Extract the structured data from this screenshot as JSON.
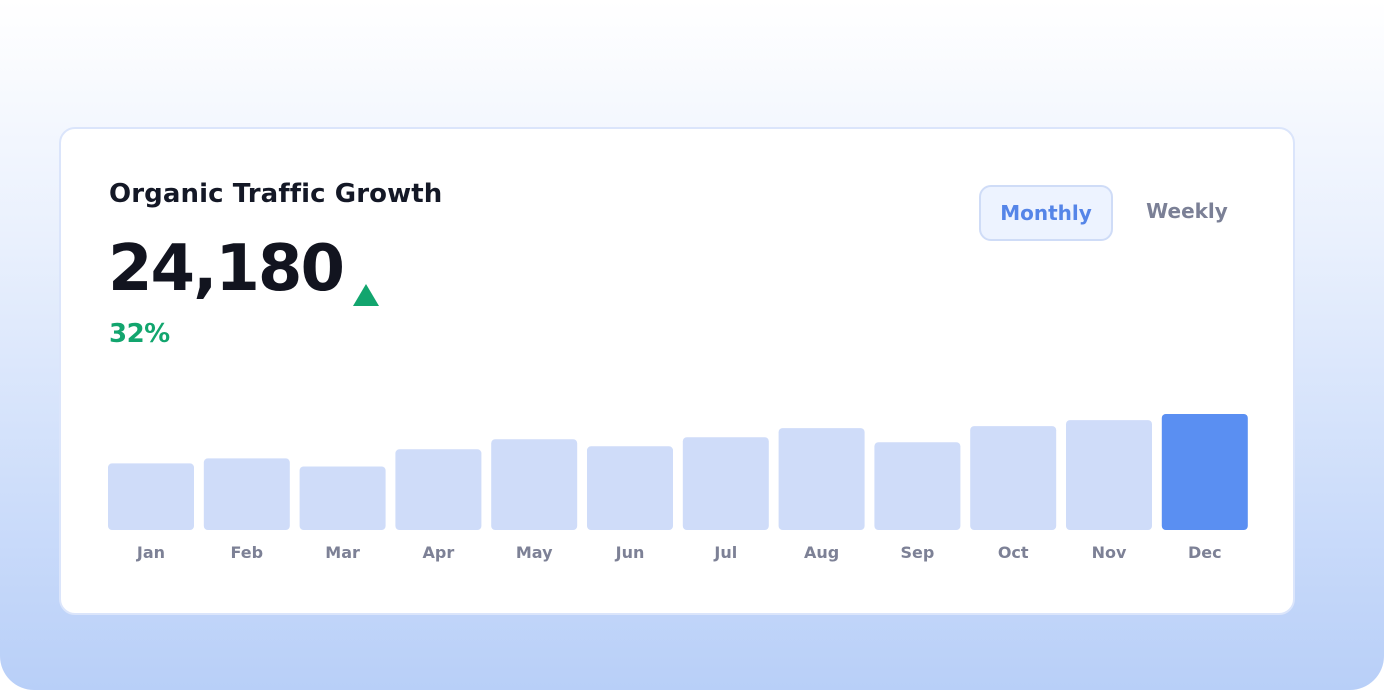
{
  "card": {
    "title": "Organic Traffic Growth",
    "value": "24,180",
    "trend_icon": "triangle-up-icon",
    "change": "32%"
  },
  "toggle": {
    "monthly_label": "Monthly",
    "weekly_label": "Weekly",
    "selected": "Monthly"
  },
  "colors": {
    "bar": "#cfdcf9",
    "bar_highlight": "#5a8ff2",
    "positive": "#12a56e",
    "accent": "#5585e8"
  },
  "chart_data": {
    "type": "bar",
    "categories": [
      "Jan",
      "Feb",
      "Mar",
      "Apr",
      "May",
      "Jun",
      "Jul",
      "Aug",
      "Sep",
      "Oct",
      "Nov",
      "Dec"
    ],
    "values": [
      66,
      71,
      63,
      80,
      90,
      83,
      92,
      101,
      87,
      103,
      109,
      115
    ],
    "highlight": "Dec",
    "ylim": [
      0,
      115
    ],
    "grid": false,
    "title": "",
    "xlabel": "",
    "ylabel": ""
  }
}
